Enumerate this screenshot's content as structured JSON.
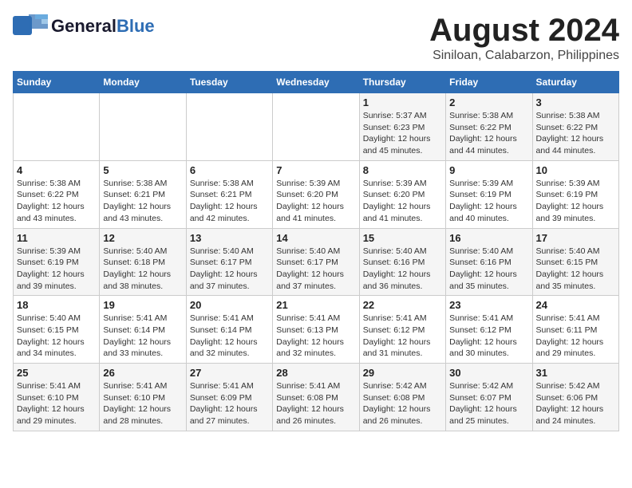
{
  "header": {
    "logo_general": "General",
    "logo_blue": "Blue",
    "title": "August 2024",
    "subtitle": "Siniloan, Calabarzon, Philippines"
  },
  "days_of_week": [
    "Sunday",
    "Monday",
    "Tuesday",
    "Wednesday",
    "Thursday",
    "Friday",
    "Saturday"
  ],
  "weeks": [
    [
      {
        "day": "",
        "info": ""
      },
      {
        "day": "",
        "info": ""
      },
      {
        "day": "",
        "info": ""
      },
      {
        "day": "",
        "info": ""
      },
      {
        "day": "1",
        "info": "Sunrise: 5:37 AM\nSunset: 6:23 PM\nDaylight: 12 hours\nand 45 minutes."
      },
      {
        "day": "2",
        "info": "Sunrise: 5:38 AM\nSunset: 6:22 PM\nDaylight: 12 hours\nand 44 minutes."
      },
      {
        "day": "3",
        "info": "Sunrise: 5:38 AM\nSunset: 6:22 PM\nDaylight: 12 hours\nand 44 minutes."
      }
    ],
    [
      {
        "day": "4",
        "info": "Sunrise: 5:38 AM\nSunset: 6:22 PM\nDaylight: 12 hours\nand 43 minutes."
      },
      {
        "day": "5",
        "info": "Sunrise: 5:38 AM\nSunset: 6:21 PM\nDaylight: 12 hours\nand 43 minutes."
      },
      {
        "day": "6",
        "info": "Sunrise: 5:38 AM\nSunset: 6:21 PM\nDaylight: 12 hours\nand 42 minutes."
      },
      {
        "day": "7",
        "info": "Sunrise: 5:39 AM\nSunset: 6:20 PM\nDaylight: 12 hours\nand 41 minutes."
      },
      {
        "day": "8",
        "info": "Sunrise: 5:39 AM\nSunset: 6:20 PM\nDaylight: 12 hours\nand 41 minutes."
      },
      {
        "day": "9",
        "info": "Sunrise: 5:39 AM\nSunset: 6:19 PM\nDaylight: 12 hours\nand 40 minutes."
      },
      {
        "day": "10",
        "info": "Sunrise: 5:39 AM\nSunset: 6:19 PM\nDaylight: 12 hours\nand 39 minutes."
      }
    ],
    [
      {
        "day": "11",
        "info": "Sunrise: 5:39 AM\nSunset: 6:19 PM\nDaylight: 12 hours\nand 39 minutes."
      },
      {
        "day": "12",
        "info": "Sunrise: 5:40 AM\nSunset: 6:18 PM\nDaylight: 12 hours\nand 38 minutes."
      },
      {
        "day": "13",
        "info": "Sunrise: 5:40 AM\nSunset: 6:17 PM\nDaylight: 12 hours\nand 37 minutes."
      },
      {
        "day": "14",
        "info": "Sunrise: 5:40 AM\nSunset: 6:17 PM\nDaylight: 12 hours\nand 37 minutes."
      },
      {
        "day": "15",
        "info": "Sunrise: 5:40 AM\nSunset: 6:16 PM\nDaylight: 12 hours\nand 36 minutes."
      },
      {
        "day": "16",
        "info": "Sunrise: 5:40 AM\nSunset: 6:16 PM\nDaylight: 12 hours\nand 35 minutes."
      },
      {
        "day": "17",
        "info": "Sunrise: 5:40 AM\nSunset: 6:15 PM\nDaylight: 12 hours\nand 35 minutes."
      }
    ],
    [
      {
        "day": "18",
        "info": "Sunrise: 5:40 AM\nSunset: 6:15 PM\nDaylight: 12 hours\nand 34 minutes."
      },
      {
        "day": "19",
        "info": "Sunrise: 5:41 AM\nSunset: 6:14 PM\nDaylight: 12 hours\nand 33 minutes."
      },
      {
        "day": "20",
        "info": "Sunrise: 5:41 AM\nSunset: 6:14 PM\nDaylight: 12 hours\nand 32 minutes."
      },
      {
        "day": "21",
        "info": "Sunrise: 5:41 AM\nSunset: 6:13 PM\nDaylight: 12 hours\nand 32 minutes."
      },
      {
        "day": "22",
        "info": "Sunrise: 5:41 AM\nSunset: 6:12 PM\nDaylight: 12 hours\nand 31 minutes."
      },
      {
        "day": "23",
        "info": "Sunrise: 5:41 AM\nSunset: 6:12 PM\nDaylight: 12 hours\nand 30 minutes."
      },
      {
        "day": "24",
        "info": "Sunrise: 5:41 AM\nSunset: 6:11 PM\nDaylight: 12 hours\nand 29 minutes."
      }
    ],
    [
      {
        "day": "25",
        "info": "Sunrise: 5:41 AM\nSunset: 6:10 PM\nDaylight: 12 hours\nand 29 minutes."
      },
      {
        "day": "26",
        "info": "Sunrise: 5:41 AM\nSunset: 6:10 PM\nDaylight: 12 hours\nand 28 minutes."
      },
      {
        "day": "27",
        "info": "Sunrise: 5:41 AM\nSunset: 6:09 PM\nDaylight: 12 hours\nand 27 minutes."
      },
      {
        "day": "28",
        "info": "Sunrise: 5:41 AM\nSunset: 6:08 PM\nDaylight: 12 hours\nand 26 minutes."
      },
      {
        "day": "29",
        "info": "Sunrise: 5:42 AM\nSunset: 6:08 PM\nDaylight: 12 hours\nand 26 minutes."
      },
      {
        "day": "30",
        "info": "Sunrise: 5:42 AM\nSunset: 6:07 PM\nDaylight: 12 hours\nand 25 minutes."
      },
      {
        "day": "31",
        "info": "Sunrise: 5:42 AM\nSunset: 6:06 PM\nDaylight: 12 hours\nand 24 minutes."
      }
    ]
  ]
}
